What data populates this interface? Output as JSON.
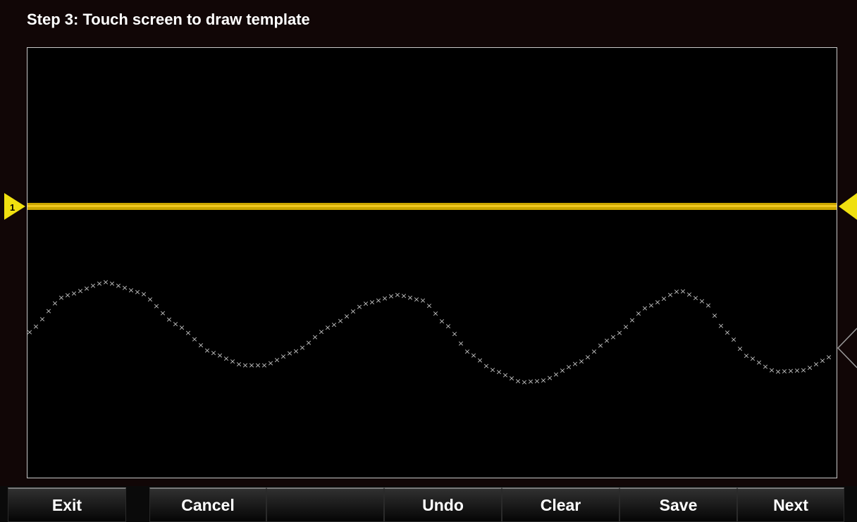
{
  "header": {
    "title": "Step 3: Touch screen to draw template"
  },
  "channel": {
    "marker_label": "1",
    "color": "#e8c000",
    "marker_color": "#f0e010"
  },
  "template": {
    "color": "#bdbdbd",
    "marker_symbol": "×"
  },
  "softkeys": [
    {
      "id": "exit",
      "label": "Exit"
    },
    {
      "id": "cancel",
      "label": "Cancel"
    },
    {
      "id": "blank",
      "label": ""
    },
    {
      "id": "undo",
      "label": "Undo"
    },
    {
      "id": "clear",
      "label": "Clear"
    },
    {
      "id": "save",
      "label": "Save"
    },
    {
      "id": "next",
      "label": "Next"
    }
  ]
}
